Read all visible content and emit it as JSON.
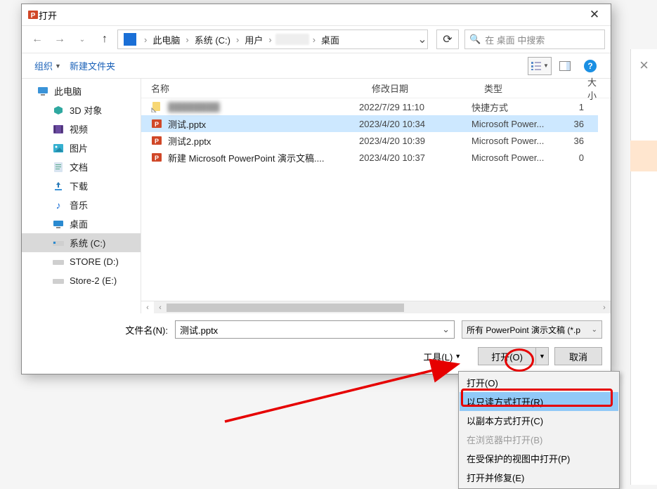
{
  "title": "打开",
  "breadcrumb": {
    "root": "此电脑",
    "drive": "系统 (C:)",
    "users": "用户",
    "hidden": "",
    "desktop": "桌面"
  },
  "search_placeholder": "在 桌面 中搜索",
  "toolbar": {
    "organize": "组织",
    "newfolder": "新建文件夹"
  },
  "columns": {
    "name": "名称",
    "date": "修改日期",
    "type": "类型",
    "size": "大小"
  },
  "sidebar": {
    "items": [
      {
        "label": "此电脑"
      },
      {
        "label": "3D 对象"
      },
      {
        "label": "视频"
      },
      {
        "label": "图片"
      },
      {
        "label": "文档"
      },
      {
        "label": "下载"
      },
      {
        "label": "音乐"
      },
      {
        "label": "桌面"
      },
      {
        "label": "系统 (C:)"
      },
      {
        "label": "STORE (D:)"
      },
      {
        "label": "Store-2 (E:)"
      }
    ]
  },
  "files": [
    {
      "name": "(redacted)",
      "date": "2022/7/29 11:10",
      "type": "快捷方式",
      "size": "1"
    },
    {
      "name": "测试.pptx",
      "date": "2023/4/20 10:34",
      "type": "Microsoft Power...",
      "size": "36"
    },
    {
      "name": "测试2.pptx",
      "date": "2023/4/20 10:39",
      "type": "Microsoft Power...",
      "size": "36"
    },
    {
      "name": "新建 Microsoft PowerPoint 演示文稿....",
      "date": "2023/4/20 10:37",
      "type": "Microsoft Power...",
      "size": "0"
    }
  ],
  "filename_label": "文件名(N):",
  "filename_value": "测试.pptx",
  "filetype_value": "所有 PowerPoint 演示文稿 (*.p",
  "tools_label": "工具(L)",
  "open_label": "打开(O)",
  "cancel_label": "取消",
  "dropdown": {
    "open": "打开(O)",
    "readonly": "以只读方式打开(R)",
    "copy": "以副本方式打开(C)",
    "browser": "在浏览器中打开(B)",
    "protected": "在受保护的视图中打开(P)",
    "repair": "打开并修复(E)"
  }
}
